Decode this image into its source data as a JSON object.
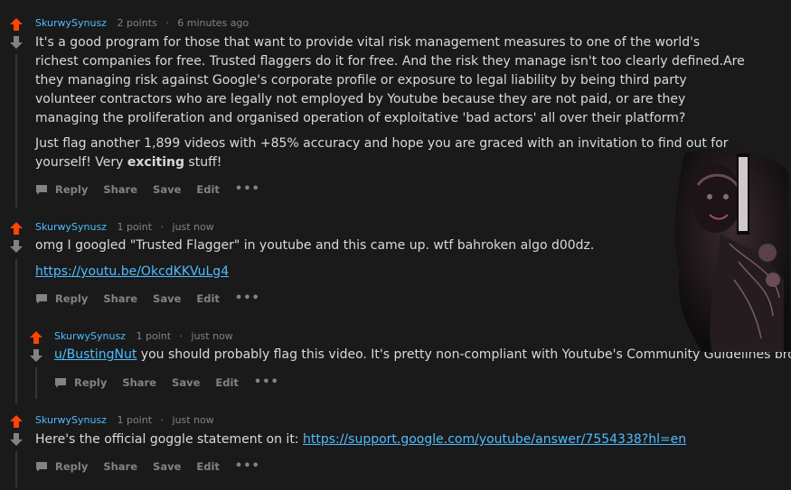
{
  "comments": [
    {
      "author": "SkurwySynusz",
      "points": "2 points",
      "time": "6 minutes ago",
      "paragraph1": "It's a good program for those that want to provide vital risk management measures to one of the world's richest companies for free. Trusted flaggers do it for free. And the risk they manage isn't too clearly defined.Are they managing risk against Google's corporate profile or exposure to legal liability by being third party volunteer contractors who are legally not employed by Youtube because they are not paid, or are they managing the proliferation and organised operation of exploitative 'bad actors' all over their platform?",
      "paragraph2_pre": "Just flag another 1,899 videos with +85% accuracy and hope you are graced with an invitation to find out for yourself! Very ",
      "paragraph2_bold": "exciting",
      "paragraph2_post": " stuff!"
    },
    {
      "author": "SkurwySynusz",
      "points": "1 point",
      "time": "just now",
      "text": "omg I googled \"Trusted Flagger\" in youtube and this came up. wtf bahroken algo d00dz.",
      "link": "https://youtu.be/OkcdKKVuLg4"
    },
    {
      "author": "SkurwySynusz",
      "points": "1 point",
      "time": "just now",
      "mention": "u/BustingNut",
      "text": " you should probably flag this video. It's pretty non-compliant with Youtube's Community Guidelines bro"
    },
    {
      "author": "SkurwySynusz",
      "points": "1 point",
      "time": "just now",
      "text": "Here's the official goggle statement on it: ",
      "link": "https://support.google.com/youtube/answer/7554338?hl=en"
    }
  ],
  "actions": {
    "reply": "Reply",
    "share": "Share",
    "save": "Save",
    "edit": "Edit",
    "more": "•••"
  },
  "colors": {
    "background": "#1a1a1b",
    "upvote": "#ff4500",
    "downvote": "#818384",
    "author": "#4fbcff",
    "link": "#4fbcff",
    "text": "#d7dadc",
    "meta": "#818384"
  }
}
